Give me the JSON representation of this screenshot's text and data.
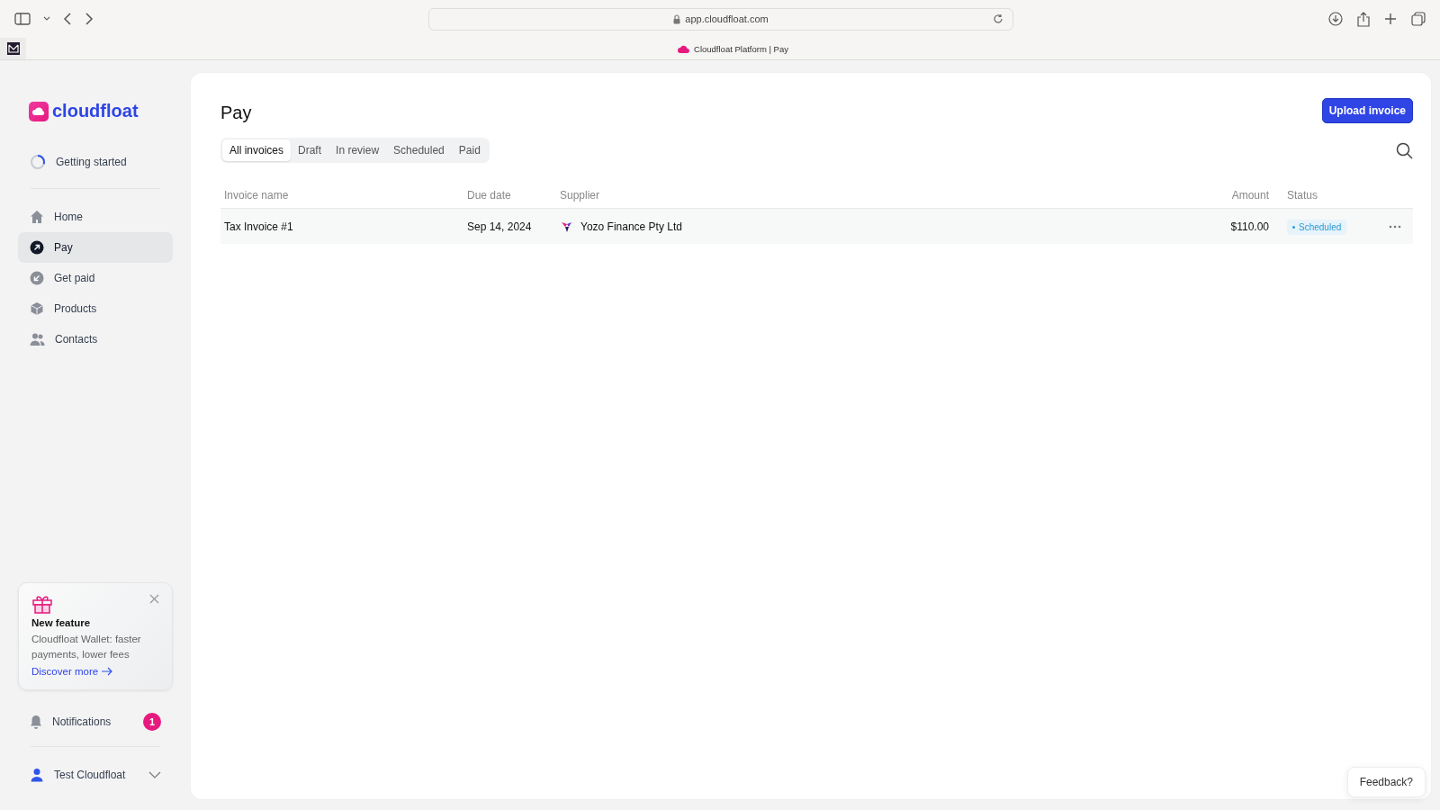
{
  "browser": {
    "url": "app.cloudfloat.com",
    "tab_title": "Cloudfloat Platform | Pay"
  },
  "sidebar": {
    "logo": "cloudfloat",
    "getting_started": {
      "label": "Getting started",
      "level": 0.3
    },
    "items": [
      {
        "label": "Home",
        "selected": false
      },
      {
        "label": "Pay",
        "selected": true
      },
      {
        "label": "Get paid",
        "selected": false
      },
      {
        "label": "Products",
        "selected": false
      },
      {
        "label": "Contacts",
        "selected": false
      }
    ],
    "promo": {
      "title": "New feature",
      "text": "Cloudfloat Wallet: faster payments, lower fees",
      "link": "Discover more"
    },
    "notifications": {
      "label": "Notifications",
      "count": "1"
    },
    "user": {
      "name": "Test Cloudfloat"
    }
  },
  "page": {
    "title": "Pay",
    "primary_button": "Upload invoice",
    "tabs": [
      {
        "label": "All invoices",
        "selected": true
      },
      {
        "label": "Draft",
        "selected": false
      },
      {
        "label": "In review",
        "selected": false
      },
      {
        "label": "Scheduled",
        "selected": false
      },
      {
        "label": "Paid",
        "selected": false
      }
    ]
  },
  "table": {
    "columns": [
      "Invoice name",
      "Due date",
      "Supplier",
      "Amount",
      "Status"
    ],
    "rows": [
      {
        "invoice_name": "Tax Invoice #1",
        "due_date": "Sep 14, 2024",
        "supplier": "Yozo Finance Pty Ltd",
        "amount": "$110.00",
        "status": "Scheduled"
      }
    ]
  },
  "feedback": "Feedback?"
}
